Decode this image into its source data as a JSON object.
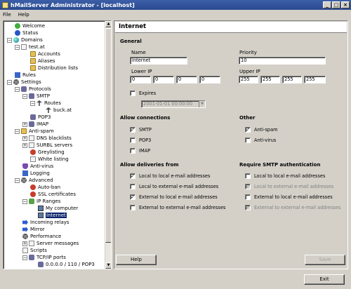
{
  "window": {
    "title": "hMailServer Administrator - [localhost]"
  },
  "menu": {
    "file": "File",
    "help": "Help"
  },
  "tree": {
    "items": [
      {
        "label": "Welcome"
      },
      {
        "label": "Status"
      },
      {
        "label": "Domains"
      },
      {
        "label": "test.at"
      },
      {
        "label": "Accounts"
      },
      {
        "label": "Aliases"
      },
      {
        "label": "Distribution lists"
      },
      {
        "label": "Rules"
      },
      {
        "label": "Settings"
      },
      {
        "label": "Protocols"
      },
      {
        "label": "SMTP"
      },
      {
        "label": "Routes"
      },
      {
        "label": "buck.at"
      },
      {
        "label": "POP3"
      },
      {
        "label": "IMAP"
      },
      {
        "label": "Anti-spam"
      },
      {
        "label": "DNS blacklists"
      },
      {
        "label": "SURBL servers"
      },
      {
        "label": "Greylisting"
      },
      {
        "label": "White listing"
      },
      {
        "label": "Anti-virus"
      },
      {
        "label": "Logging"
      },
      {
        "label": "Advanced"
      },
      {
        "label": "Auto-ban"
      },
      {
        "label": "SSL certificates"
      },
      {
        "label": "IP Ranges"
      },
      {
        "label": "My computer"
      },
      {
        "label": "Internet"
      },
      {
        "label": "Incoming relays"
      },
      {
        "label": "Mirror"
      },
      {
        "label": "Performance"
      },
      {
        "label": "Server messages"
      },
      {
        "label": "Scripts"
      },
      {
        "label": "TCP/IP ports"
      },
      {
        "label": "0.0.0.0 / 110 / POP3"
      }
    ]
  },
  "panel": {
    "title": "Internet",
    "general": {
      "heading": "General",
      "name_label": "Name",
      "name_value": "Internet",
      "priority_label": "Priority",
      "priority_value": "10",
      "lower_ip_label": "Lower IP",
      "lower_ip": [
        "0",
        "0",
        "0",
        "0"
      ],
      "upper_ip_label": "Upper IP",
      "upper_ip": [
        "255",
        "255",
        "255",
        "255"
      ],
      "expires_label": "Expires",
      "expires_value": "2001-01-01 00:00:00"
    },
    "allow_connections": {
      "heading": "Allow connections",
      "smtp": "SMTP",
      "pop3": "POP3",
      "imap": "IMAP"
    },
    "other": {
      "heading": "Other",
      "antispam": "Anti-spam",
      "antivirus": "Anti-virus"
    },
    "allow_deliveries": {
      "heading": "Allow deliveries from",
      "l2l": "Local to local e-mail addresses",
      "l2e": "Local to external e-mail addresses",
      "e2l": "External to local e-mail addresses",
      "e2e": "External to external e-mail addresses"
    },
    "require_auth": {
      "heading": "Require SMTP authentication",
      "l2l": "Local to local e-mail addresses",
      "l2e": "Local to external e-mail addresses",
      "e2l": "External to local e-mail addresses",
      "e2e": "External to external e-mail addresses"
    },
    "help_button": "Help",
    "save_button": "Save"
  },
  "exit_button": "Exit"
}
